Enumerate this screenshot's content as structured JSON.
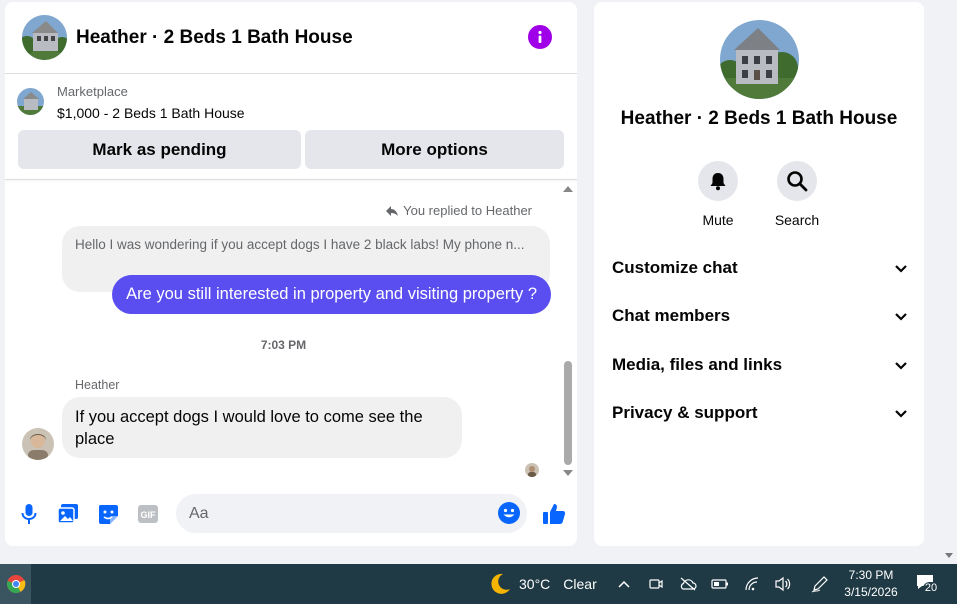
{
  "chat": {
    "title": "Heather · 2 Beds 1 Bath House",
    "marketplace_label": "Marketplace",
    "listing": "$1,000 - 2 Beds 1 Bath House",
    "mark_pending_label": "Mark as pending",
    "more_options_label": "More options",
    "replied_note": "You replied to Heather",
    "quoted_message": "Hello I was wondering if you accept dogs I have 2 black labs! My phone n...",
    "outgoing_message": "Are you still interested in property and visiting property ?",
    "timestamp": "7:03 PM",
    "sender_name": "Heather",
    "incoming_message": "If you accept dogs I would love to come see the place",
    "input_placeholder": "Aa"
  },
  "details": {
    "title": "Heather · 2 Beds 1 Bath House",
    "actions": [
      {
        "label": "Mute",
        "icon": "bell-icon"
      },
      {
        "label": "Search",
        "icon": "search-icon"
      }
    ],
    "sections": [
      {
        "label": "Customize chat"
      },
      {
        "label": "Chat members"
      },
      {
        "label": "Media, files and links"
      },
      {
        "label": "Privacy & support"
      }
    ]
  },
  "taskbar": {
    "temperature": "30°C",
    "condition": "Clear",
    "time": "7:30 PM",
    "date": "3/15/2026",
    "notification_count": "20"
  },
  "colors": {
    "accent": "#0866ff",
    "outgoing_bubble": "#5b4ef0",
    "info_button": "#a000e8",
    "taskbar": "#1f3a44"
  }
}
